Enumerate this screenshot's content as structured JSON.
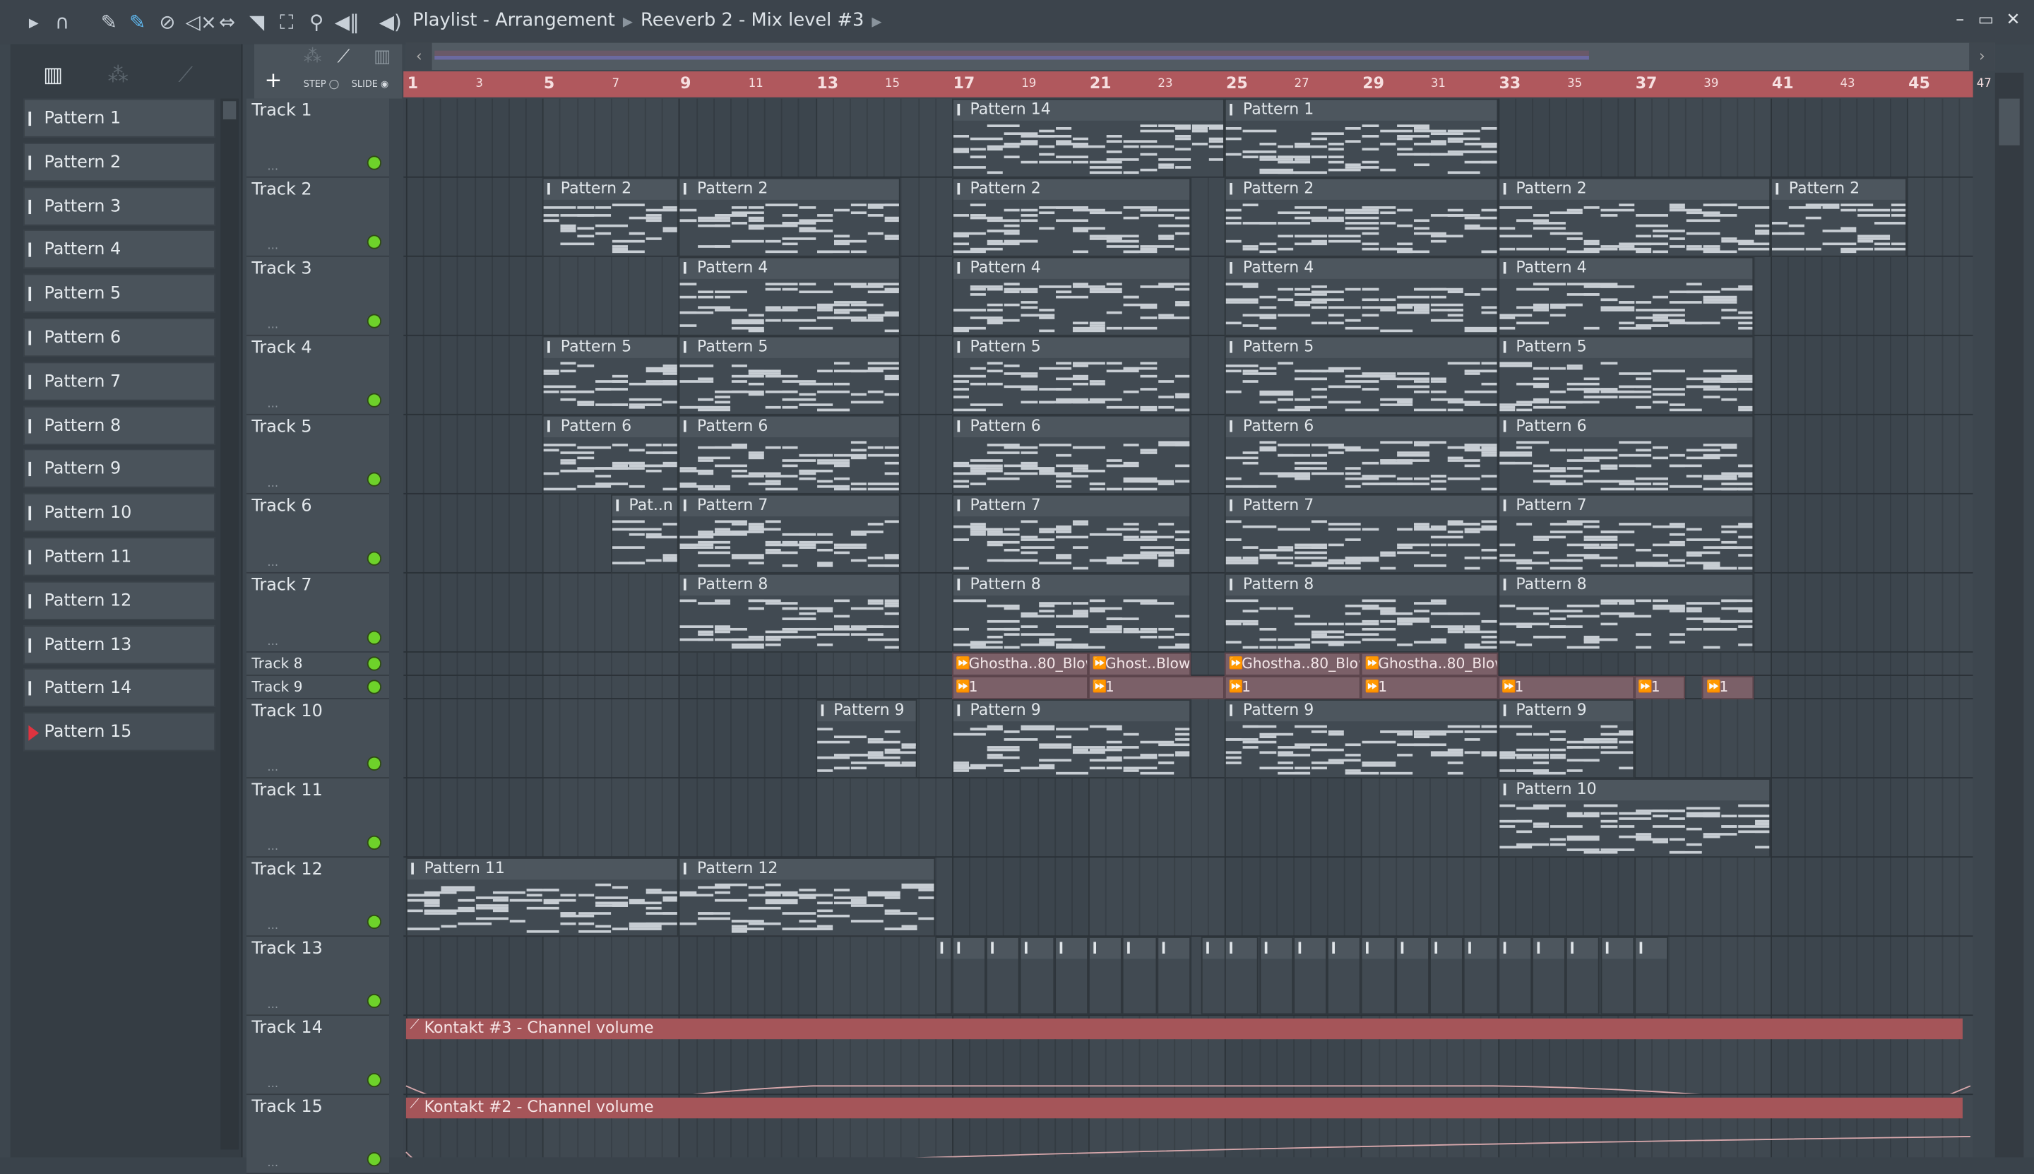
{
  "titlebar": {
    "title": "Playlist - Arrangement",
    "subtitle": "Reeverb 2 - Mix level #3",
    "icons": [
      "play-arrow-icon",
      "magnet-icon",
      "pencil-icon",
      "paint-brush-icon",
      "delete-icon",
      "mute-icon",
      "slip-icon",
      "slice-icon",
      "select-icon",
      "zoom-icon",
      "playback-icon",
      "speaker-icon"
    ]
  },
  "ctrl": {
    "step": "STEP",
    "slide": "SLIDE",
    "add": "+"
  },
  "ruler": {
    "first_bar": 1,
    "last_bar": 47,
    "labels": [
      "1",
      "3",
      "5",
      "7",
      "9",
      "11",
      "13",
      "15",
      "17",
      "19",
      "21",
      "23",
      "25",
      "27",
      "29",
      "31",
      "33",
      "35",
      "37",
      "39",
      "41",
      "43",
      "45",
      "47"
    ]
  },
  "patterns": [
    "Pattern 1",
    "Pattern 2",
    "Pattern 3",
    "Pattern 4",
    "Pattern 5",
    "Pattern 6",
    "Pattern 7",
    "Pattern 8",
    "Pattern 9",
    "Pattern 10",
    "Pattern 11",
    "Pattern 12",
    "Pattern 13",
    "Pattern 14",
    "Pattern 15"
  ],
  "selected_pattern": "Pattern 15",
  "tracks": [
    {
      "name": "Track 1",
      "clips": [
        {
          "label": "Pattern 14",
          "start": 17,
          "len": 8
        },
        {
          "label": "Pattern 1",
          "start": 25,
          "len": 8
        }
      ]
    },
    {
      "name": "Track 2",
      "clips": [
        {
          "label": "Pattern 2",
          "start": 5,
          "len": 4
        },
        {
          "label": "Pattern 2",
          "start": 9,
          "len": 6.5
        },
        {
          "label": "Pattern 2",
          "start": 17,
          "len": 7
        },
        {
          "label": "Pattern 2",
          "start": 25,
          "len": 8
        },
        {
          "label": "Pattern 2",
          "start": 33,
          "len": 8
        },
        {
          "label": "Pattern 2",
          "start": 41,
          "len": 4
        }
      ]
    },
    {
      "name": "Track 3",
      "clips": [
        {
          "label": "Pattern 4",
          "start": 9,
          "len": 6.5
        },
        {
          "label": "Pattern 4",
          "start": 17,
          "len": 7
        },
        {
          "label": "Pattern 4",
          "start": 25,
          "len": 8
        },
        {
          "label": "Pattern 4",
          "start": 33,
          "len": 7.5
        }
      ]
    },
    {
      "name": "Track 4",
      "clips": [
        {
          "label": "Pattern 5",
          "start": 5,
          "len": 4
        },
        {
          "label": "Pattern 5",
          "start": 9,
          "len": 6.5
        },
        {
          "label": "Pattern 5",
          "start": 17,
          "len": 7
        },
        {
          "label": "Pattern 5",
          "start": 25,
          "len": 8
        },
        {
          "label": "Pattern 5",
          "start": 33,
          "len": 7.5
        }
      ]
    },
    {
      "name": "Track 5",
      "clips": [
        {
          "label": "Pattern 6",
          "start": 5,
          "len": 4
        },
        {
          "label": "Pattern 6",
          "start": 9,
          "len": 6.5
        },
        {
          "label": "Pattern 6",
          "start": 17,
          "len": 7
        },
        {
          "label": "Pattern 6",
          "start": 25,
          "len": 8
        },
        {
          "label": "Pattern 6",
          "start": 33,
          "len": 7.5
        }
      ]
    },
    {
      "name": "Track 6",
      "clips": [
        {
          "label": "Pat..n 7",
          "start": 7,
          "len": 2
        },
        {
          "label": "Pattern 7",
          "start": 9,
          "len": 6.5
        },
        {
          "label": "Pattern 7",
          "start": 17,
          "len": 7
        },
        {
          "label": "Pattern 7",
          "start": 25,
          "len": 8
        },
        {
          "label": "Pattern 7",
          "start": 33,
          "len": 7.5
        }
      ]
    },
    {
      "name": "Track 7",
      "clips": [
        {
          "label": "Pattern 8",
          "start": 9,
          "len": 6.5
        },
        {
          "label": "Pattern 8",
          "start": 17,
          "len": 7
        },
        {
          "label": "Pattern 8",
          "start": 25,
          "len": 8
        },
        {
          "label": "Pattern 8",
          "start": 33,
          "len": 7.5
        }
      ]
    },
    {
      "name": "Track 8",
      "small": true,
      "audio": true,
      "clips": [
        {
          "label": "Ghostha..80_Blow",
          "start": 17,
          "len": 4
        },
        {
          "label": "Ghost..Blow",
          "start": 21,
          "len": 3
        },
        {
          "label": "Ghostha..80_Blow",
          "start": 25,
          "len": 4
        },
        {
          "label": "Ghostha..80_Blow",
          "start": 29,
          "len": 4
        }
      ]
    },
    {
      "name": "Track 9",
      "small": true,
      "audio": true,
      "clips": [
        {
          "label": "1",
          "start": 17,
          "len": 4
        },
        {
          "label": "1",
          "start": 21,
          "len": 4
        },
        {
          "label": "1",
          "start": 25,
          "len": 4
        },
        {
          "label": "1",
          "start": 29,
          "len": 4
        },
        {
          "label": "1",
          "start": 33,
          "len": 4
        },
        {
          "label": "1",
          "start": 37,
          "len": 1.5
        },
        {
          "label": "1",
          "start": 39,
          "len": 1.5
        }
      ]
    },
    {
      "name": "Track 10",
      "clips": [
        {
          "label": "Pattern 9",
          "start": 13,
          "len": 3
        },
        {
          "label": "Pattern 9",
          "start": 17,
          "len": 7
        },
        {
          "label": "Pattern 9",
          "start": 25,
          "len": 8
        },
        {
          "label": "Pattern 9",
          "start": 33,
          "len": 4
        }
      ]
    },
    {
      "name": "Track 11",
      "clips": [
        {
          "label": "Pattern 10",
          "start": 33,
          "len": 8
        }
      ]
    },
    {
      "name": "Track 12",
      "clips": [
        {
          "label": "Pattern 11",
          "start": 1,
          "len": 8
        },
        {
          "label": "Pattern 12",
          "start": 9,
          "len": 7.5
        }
      ]
    },
    {
      "name": "Track 13",
      "mini": true,
      "clips": [
        {
          "start": 16.5
        },
        {
          "start": 17
        },
        {
          "start": 18
        },
        {
          "start": 19
        },
        {
          "start": 20
        },
        {
          "start": 21
        },
        {
          "start": 22
        },
        {
          "start": 23
        },
        {
          "start": 24.3
        },
        {
          "start": 25
        },
        {
          "start": 26
        },
        {
          "start": 27
        },
        {
          "start": 28
        },
        {
          "start": 29
        },
        {
          "start": 30
        },
        {
          "start": 31
        },
        {
          "start": 32
        },
        {
          "start": 33
        },
        {
          "start": 34
        },
        {
          "start": 35
        },
        {
          "start": 36
        },
        {
          "start": 37
        }
      ]
    },
    {
      "name": "Track 14",
      "automation": {
        "label": "Kontakt #3 - Channel volume",
        "start": 1,
        "len": 46
      }
    },
    {
      "name": "Track 15",
      "automation": {
        "label": "Kontakt #2 - Channel volume",
        "start": 1,
        "len": 46
      }
    }
  ],
  "colors": {
    "ruler": "#b0585d",
    "clip": "#414a52",
    "audio": "#7b6068",
    "automation": "#a55559",
    "track_led": "#6ed22a"
  }
}
